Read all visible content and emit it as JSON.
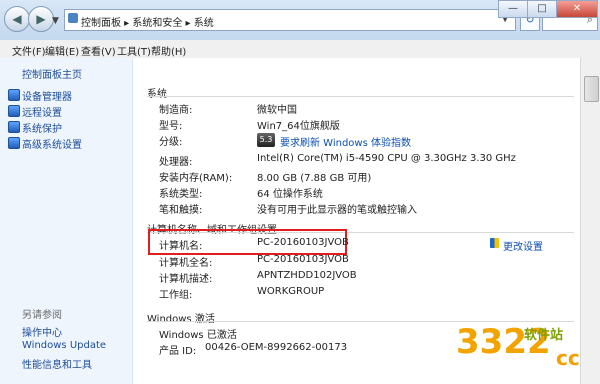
{
  "address_path": "控制面板 ▸ 系统和安全 ▸ 系统",
  "menu": [
    "文件(F)",
    "编辑(E)",
    "查看(V)",
    "工具(T)",
    "帮助(H)"
  ],
  "sidebar": {
    "home": "控制面板主页",
    "items": [
      "设备管理器",
      "远程设置",
      "系统保护",
      "高级系统设置"
    ],
    "see_also_title": "另请参阅",
    "see_also": [
      "操作中心",
      "Windows Update",
      "性能信息和工具"
    ]
  },
  "system": {
    "title": "系统",
    "rows": [
      {
        "label": "制造商:",
        "value": "微软中国"
      },
      {
        "label": "型号:",
        "value": "Win7_64位旗舰版"
      },
      {
        "label": "分级:",
        "value": "5.3",
        "link": "要求刷新 Windows 体验指数"
      },
      {
        "label": "处理器:",
        "value": "Intel(R) Core(TM) i5-4590 CPU @ 3.30GHz   3.30 GHz"
      },
      {
        "label": "安装内存(RAM):",
        "value": "8.00 GB (7.88 GB 可用)"
      },
      {
        "label": "系统类型:",
        "value": "64 位操作系统"
      },
      {
        "label": "笔和触摸:",
        "value": "没有可用于此显示器的笔或触控输入"
      }
    ]
  },
  "computer": {
    "title": "计算机名称、域和工作组设置",
    "change_settings": "更改设置",
    "rows": [
      {
        "label": "计算机名:",
        "value": "PC-20160103JVOB"
      },
      {
        "label": "计算机全名:",
        "value": "PC-20160103JVOB"
      },
      {
        "label": "计算机描述:",
        "value": "APNTZHDD102JVOB"
      },
      {
        "label": "工作组:",
        "value": "WORKGROUP"
      }
    ]
  },
  "activation": {
    "title": "Windows 激活",
    "status": "Windows 已激活",
    "product_id_label": "产品 ID:",
    "product_id": "00426-OEM-8992662-00173"
  },
  "watermark": {
    "number": "3322",
    "text": "软件站",
    "suffix": "cc"
  }
}
